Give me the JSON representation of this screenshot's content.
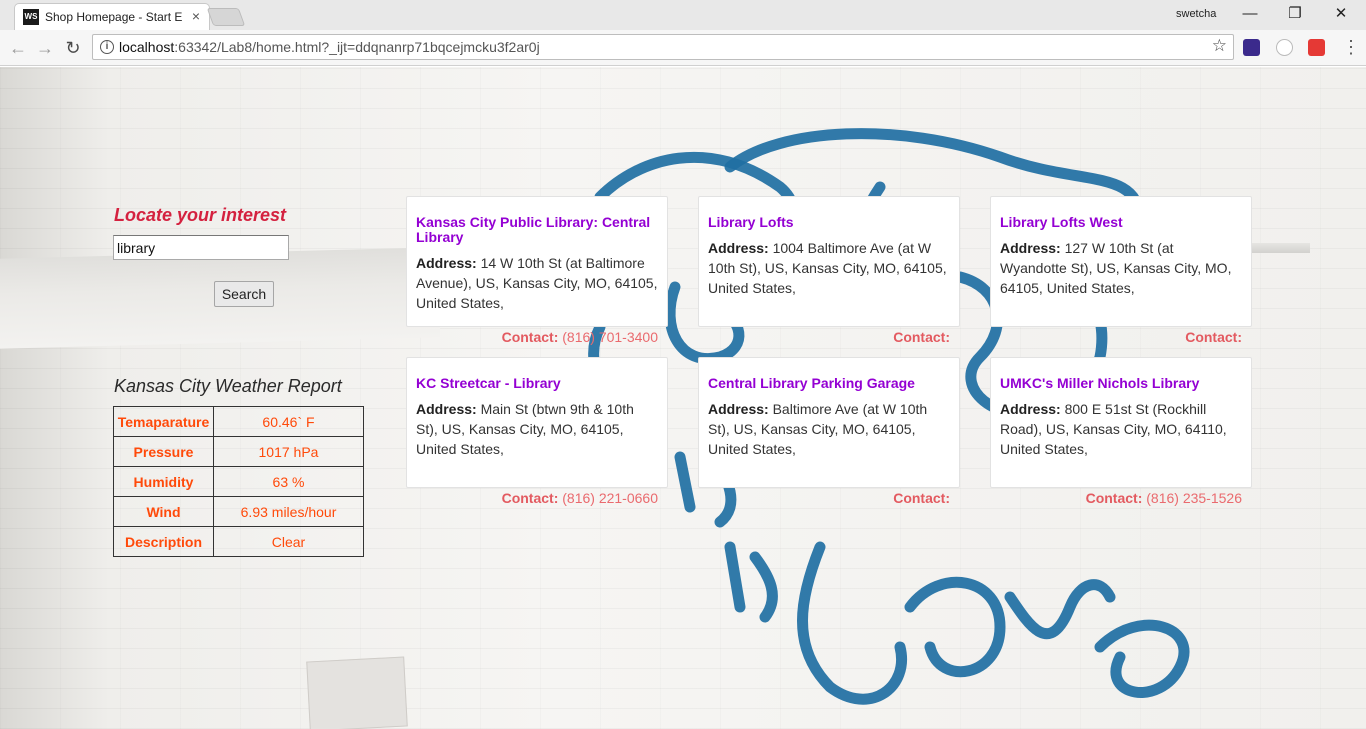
{
  "browser": {
    "tab_title": "Shop Homepage - Start E",
    "tab_icon": "WS",
    "profile_name": "swetcha",
    "url_host": "localhost",
    "url_path": ":63342/Lab8/home.html?_ijt=ddqnanrp71bqcejmcku3f2ar0j"
  },
  "search": {
    "title": "Locate your interest",
    "value": "library",
    "button_label": "Search"
  },
  "weather": {
    "title": "Kansas City Weather Report",
    "rows": [
      {
        "label": "Temaparature",
        "value": "60.46` F"
      },
      {
        "label": "Pressure",
        "value": "1017 hPa"
      },
      {
        "label": "Humidity",
        "value": "63 %"
      },
      {
        "label": "Wind",
        "value": "6.93 miles/hour"
      },
      {
        "label": "Description",
        "value": "Clear"
      }
    ]
  },
  "address_label": "Address:",
  "contact_label": "Contact:",
  "results": [
    {
      "name": "Kansas City Public Library: Central Library",
      "address": "14 W 10th St (at Baltimore Avenue), US, Kansas City, MO, 64105, United States,",
      "contact": "(816) 701-3400"
    },
    {
      "name": "Library Lofts",
      "address": "1004 Baltimore Ave (at W 10th St), US, Kansas City, MO, 64105, United States,",
      "contact": ""
    },
    {
      "name": "Library Lofts West",
      "address": "127 W 10th St (at Wyandotte St), US, Kansas City, MO, 64105, United States,",
      "contact": ""
    },
    {
      "name": "KC Streetcar - Library",
      "address": "Main St (btwn 9th & 10th St), US, Kansas City, MO, 64105, United States,",
      "contact": "(816) 221-0660"
    },
    {
      "name": "Central Library Parking Garage",
      "address": "Baltimore Ave (at W 10th St), US, Kansas City, MO, 64105, United States,",
      "contact": ""
    },
    {
      "name": "UMKC's Miller Nichols Library",
      "address": "800 E 51st St (Rockhill Road), US, Kansas City, MO, 64110, United States,",
      "contact": "(816) 235-1526"
    }
  ],
  "colors": {
    "locate_title": "#d4213f",
    "card_title": "#9400d3",
    "weather_text": "#ff4a0a",
    "contact": "#ea6a6e",
    "mural": "#1f6fa3"
  }
}
